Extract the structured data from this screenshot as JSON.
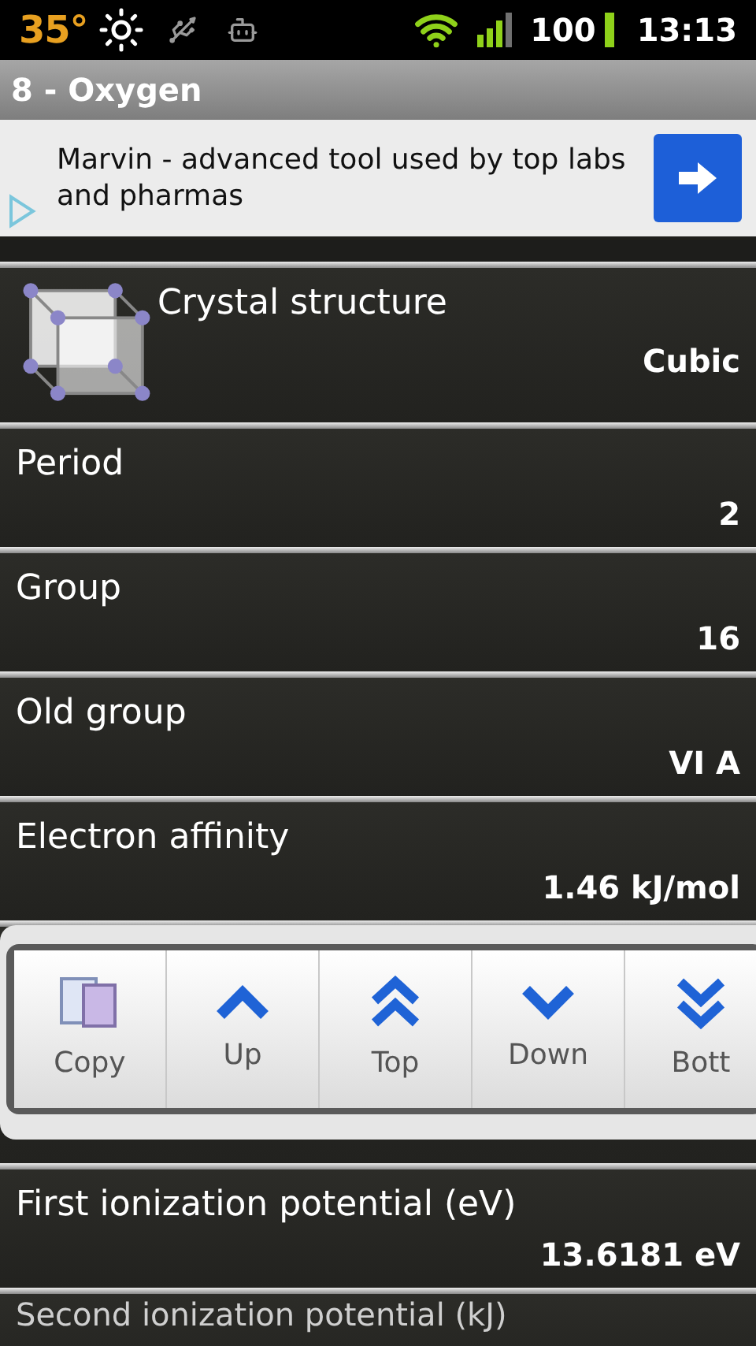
{
  "status_bar": {
    "temperature": "35°",
    "battery": "100",
    "time": "13:13"
  },
  "title": "8 - Oxygen",
  "ad": {
    "text": "Marvin - advanced tool used by top labs and pharmas"
  },
  "properties": [
    {
      "kind": "structure",
      "label": "Crystal structure",
      "value": "Cubic"
    },
    {
      "kind": "plain",
      "label": "Period",
      "value": "2"
    },
    {
      "kind": "plain",
      "label": "Group",
      "value": "16"
    },
    {
      "kind": "plain",
      "label": "Old group",
      "value": "VI A"
    },
    {
      "kind": "plain",
      "label": "Electron affinity",
      "value": "1.46 kJ/mol"
    },
    {
      "kind": "hidden"
    },
    {
      "kind": "plain",
      "label": "First ionization potential (eV)",
      "value": "13.6181 eV"
    },
    {
      "kind": "cut",
      "label": "Second ionization potential (kJ)"
    }
  ],
  "toolbar": [
    {
      "kind": "copy",
      "label": "Copy"
    },
    {
      "kind": "up",
      "label": "Up"
    },
    {
      "kind": "top",
      "label": "Top"
    },
    {
      "kind": "down",
      "label": "Down"
    },
    {
      "kind": "bottom",
      "label": "Bott"
    }
  ]
}
